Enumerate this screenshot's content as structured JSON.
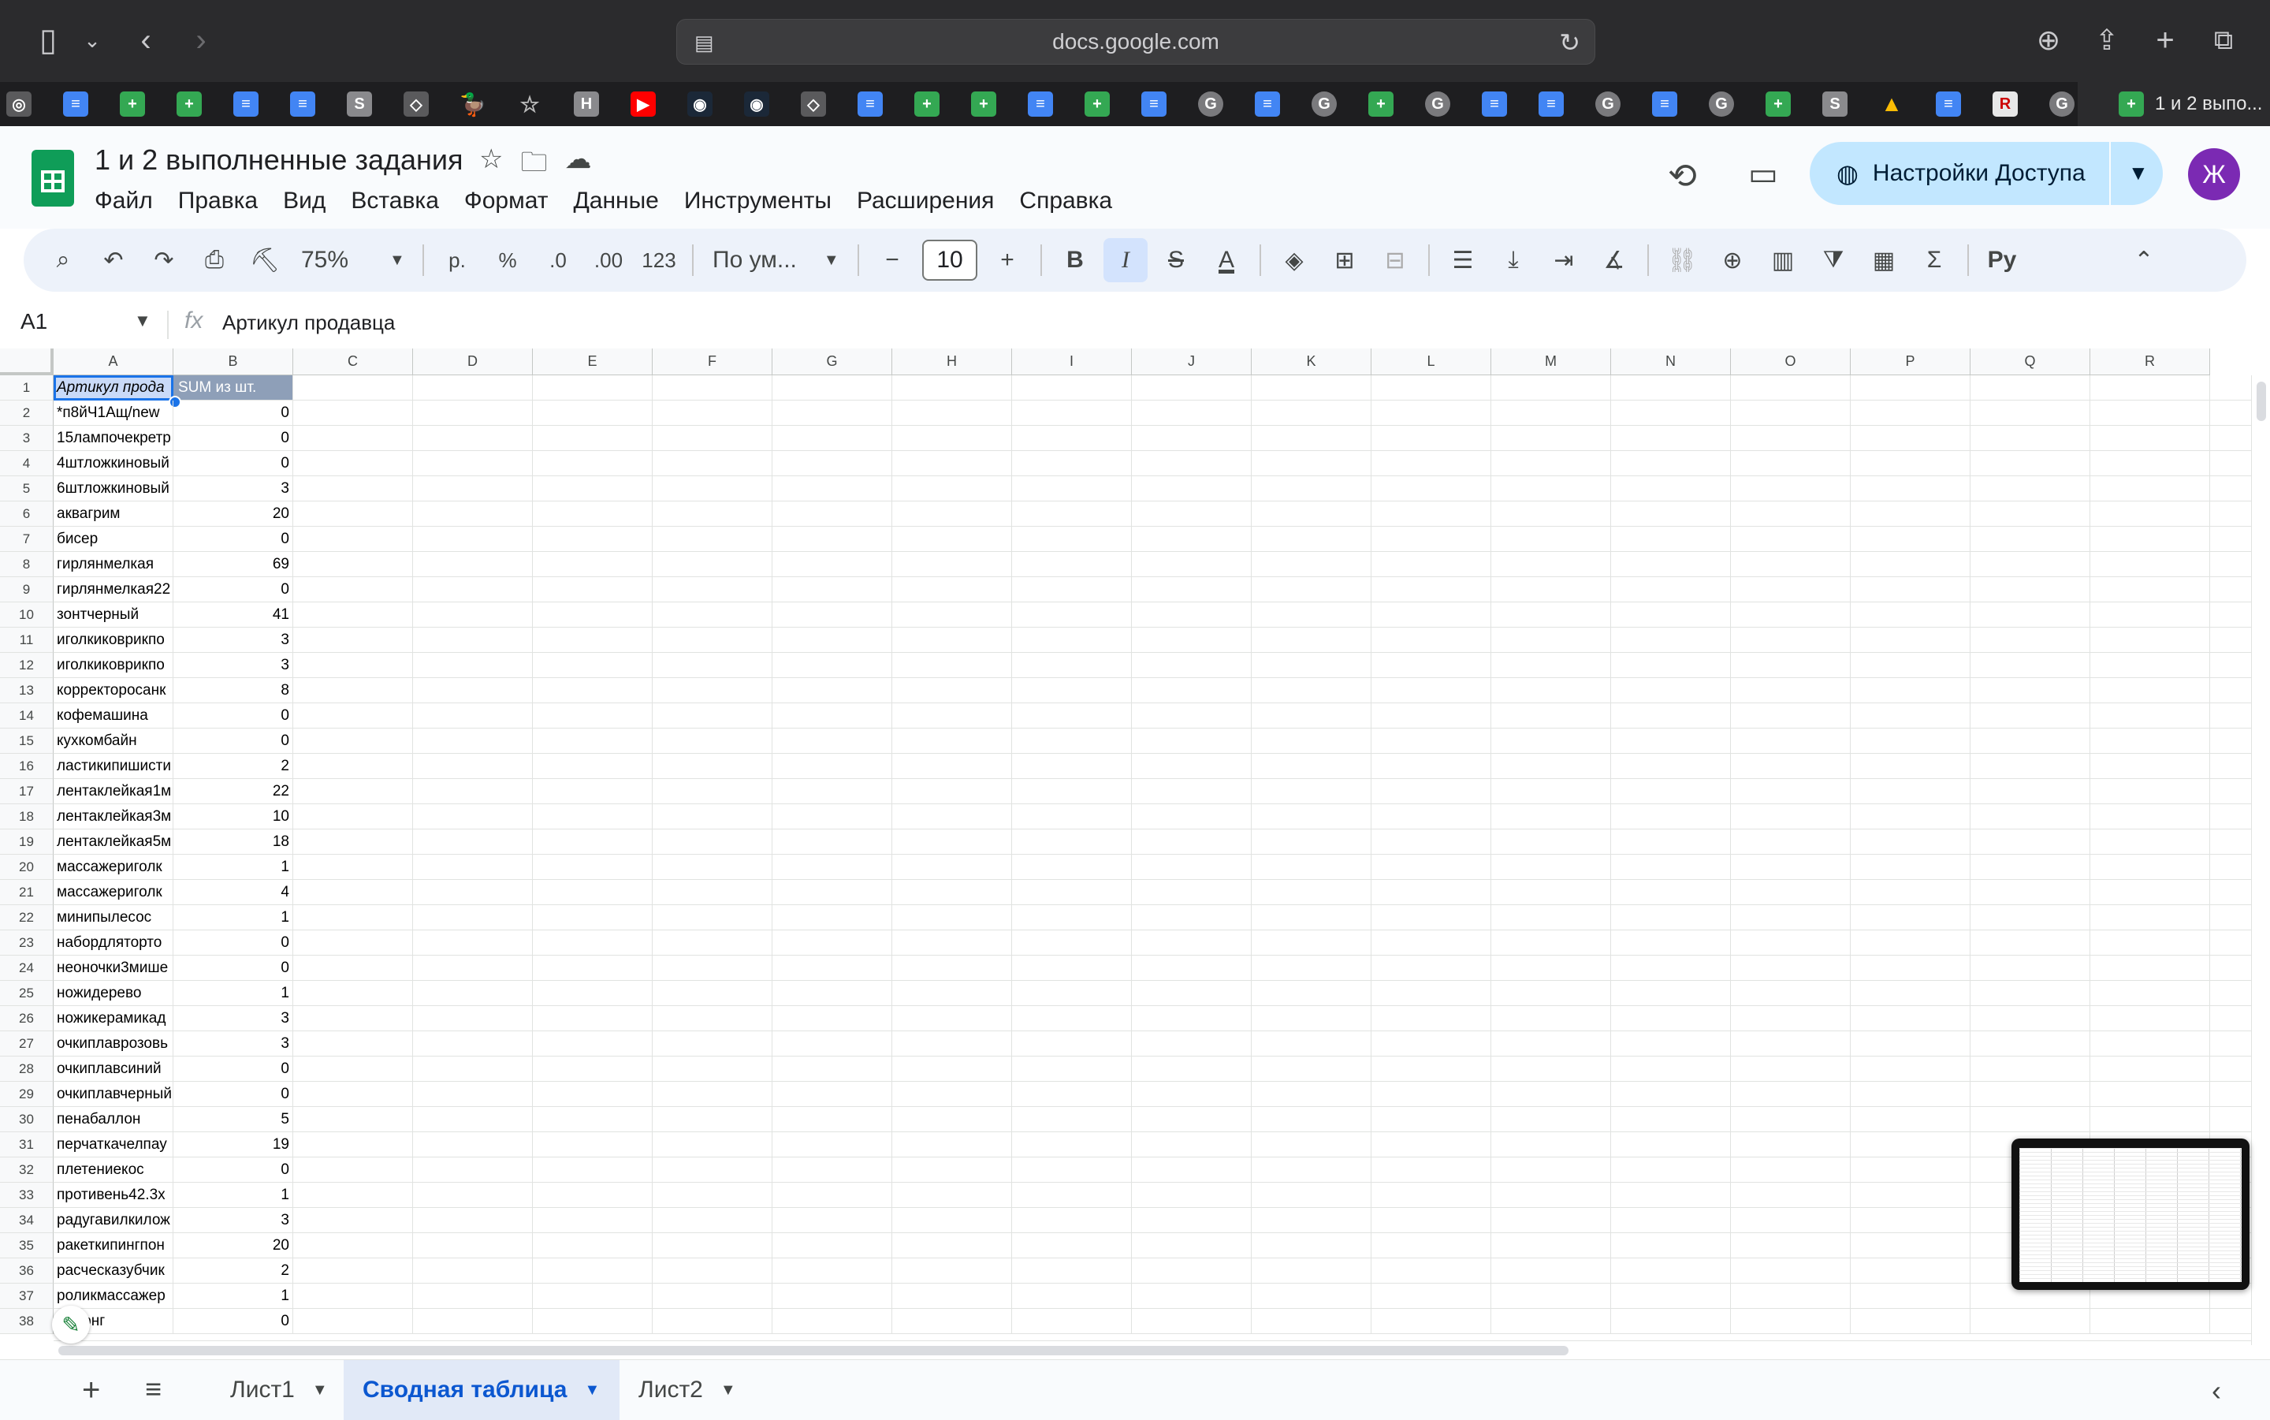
{
  "browser": {
    "url": "docs.google.com",
    "active_tab_title": "1 и 2 выпо...",
    "tab_icons": [
      "openai",
      "doc",
      "sheet",
      "sheet",
      "doc",
      "doc",
      "s",
      "misc",
      "duck",
      "star",
      "h",
      "youtube",
      "steam",
      "steam",
      "misc",
      "doc",
      "sheet",
      "sheet",
      "doc",
      "sheet",
      "doc",
      "g",
      "doc",
      "g",
      "sheet",
      "g",
      "doc",
      "doc",
      "g",
      "doc",
      "g",
      "sheet",
      "s",
      "drive",
      "doc",
      "r",
      "g"
    ]
  },
  "app": {
    "title": "1 и 2 выполненные задания",
    "menu": [
      "Файл",
      "Правка",
      "Вид",
      "Вставка",
      "Формат",
      "Данные",
      "Инструменты",
      "Расширения",
      "Справка"
    ],
    "share_label": "Настройки Доступа",
    "avatar_letter": "Ж"
  },
  "toolbar": {
    "zoom": "75%",
    "currency": "р.",
    "percent": "%",
    "dec_decrease": ".0",
    "dec_increase": ".00",
    "number_format": "123",
    "font": "По ум...",
    "font_size": "10",
    "bold": "B",
    "italic": "I",
    "strikethrough": "S",
    "text_color": "A",
    "input_tools": "Pу"
  },
  "formula_bar": {
    "cell_ref": "A1",
    "fx": "fx",
    "value": "Артикул продавца"
  },
  "columns": [
    "A",
    "B",
    "C",
    "D",
    "E",
    "F",
    "G",
    "H",
    "I",
    "J",
    "K",
    "L",
    "M",
    "N",
    "O",
    "P",
    "Q",
    "R"
  ],
  "table": {
    "header": {
      "a": "Артикул прода",
      "b": "SUM из шт."
    },
    "rows": [
      {
        "a": "*п8йЧ1Ащ/new",
        "b": "0"
      },
      {
        "a": "15лампочекретр",
        "b": "0"
      },
      {
        "a": "4штложкиновый",
        "b": "0"
      },
      {
        "a": "6штложкиновый",
        "b": "3"
      },
      {
        "a": "аквагрим",
        "b": "20"
      },
      {
        "a": "бисер",
        "b": "0"
      },
      {
        "a": "гирлянмелкая",
        "b": "69"
      },
      {
        "a": "гирлянмелкая22",
        "b": "0"
      },
      {
        "a": "зонтчерный",
        "b": "41"
      },
      {
        "a": "иголкиковрикпо",
        "b": "3"
      },
      {
        "a": "иголкиковрикпо",
        "b": "3"
      },
      {
        "a": "корректоросанк",
        "b": "8"
      },
      {
        "a": "кофемашина",
        "b": "0"
      },
      {
        "a": "кухкомбайн",
        "b": "0"
      },
      {
        "a": "ластикипишисти",
        "b": "2"
      },
      {
        "a": "лентаклейкая1м",
        "b": "22"
      },
      {
        "a": "лентаклейкая3м",
        "b": "10"
      },
      {
        "a": "лентаклейкая5м",
        "b": "18"
      },
      {
        "a": "массажериголк",
        "b": "1"
      },
      {
        "a": "массажериголк",
        "b": "4"
      },
      {
        "a": "минипылесос",
        "b": "1"
      },
      {
        "a": "набордляторто",
        "b": "0"
      },
      {
        "a": "неоночки3мише",
        "b": "0"
      },
      {
        "a": "ножидерево",
        "b": "1"
      },
      {
        "a": "ножикерамикад",
        "b": "3"
      },
      {
        "a": "очкиплаврозовь",
        "b": "3"
      },
      {
        "a": "очкиплавсиний",
        "b": "0"
      },
      {
        "a": "очкиплавчерный",
        "b": "0"
      },
      {
        "a": "пенабаллон",
        "b": "5"
      },
      {
        "a": "перчаткачелпау",
        "b": "19"
      },
      {
        "a": "плетениекос",
        "b": "0"
      },
      {
        "a": "противень42.3х",
        "b": "1"
      },
      {
        "a": "радугавилкилож",
        "b": "3"
      },
      {
        "a": "ракеткипингпон",
        "b": "20"
      },
      {
        "a": "расческазубчик",
        "b": "2"
      },
      {
        "a": "роликмассажер",
        "b": "1"
      },
      {
        "a": "самонг",
        "b": "0"
      }
    ]
  },
  "sheets": {
    "tabs": [
      {
        "label": "Лист1",
        "active": false
      },
      {
        "label": "Сводная таблица",
        "active": true
      },
      {
        "label": "Лист2",
        "active": false
      }
    ]
  }
}
